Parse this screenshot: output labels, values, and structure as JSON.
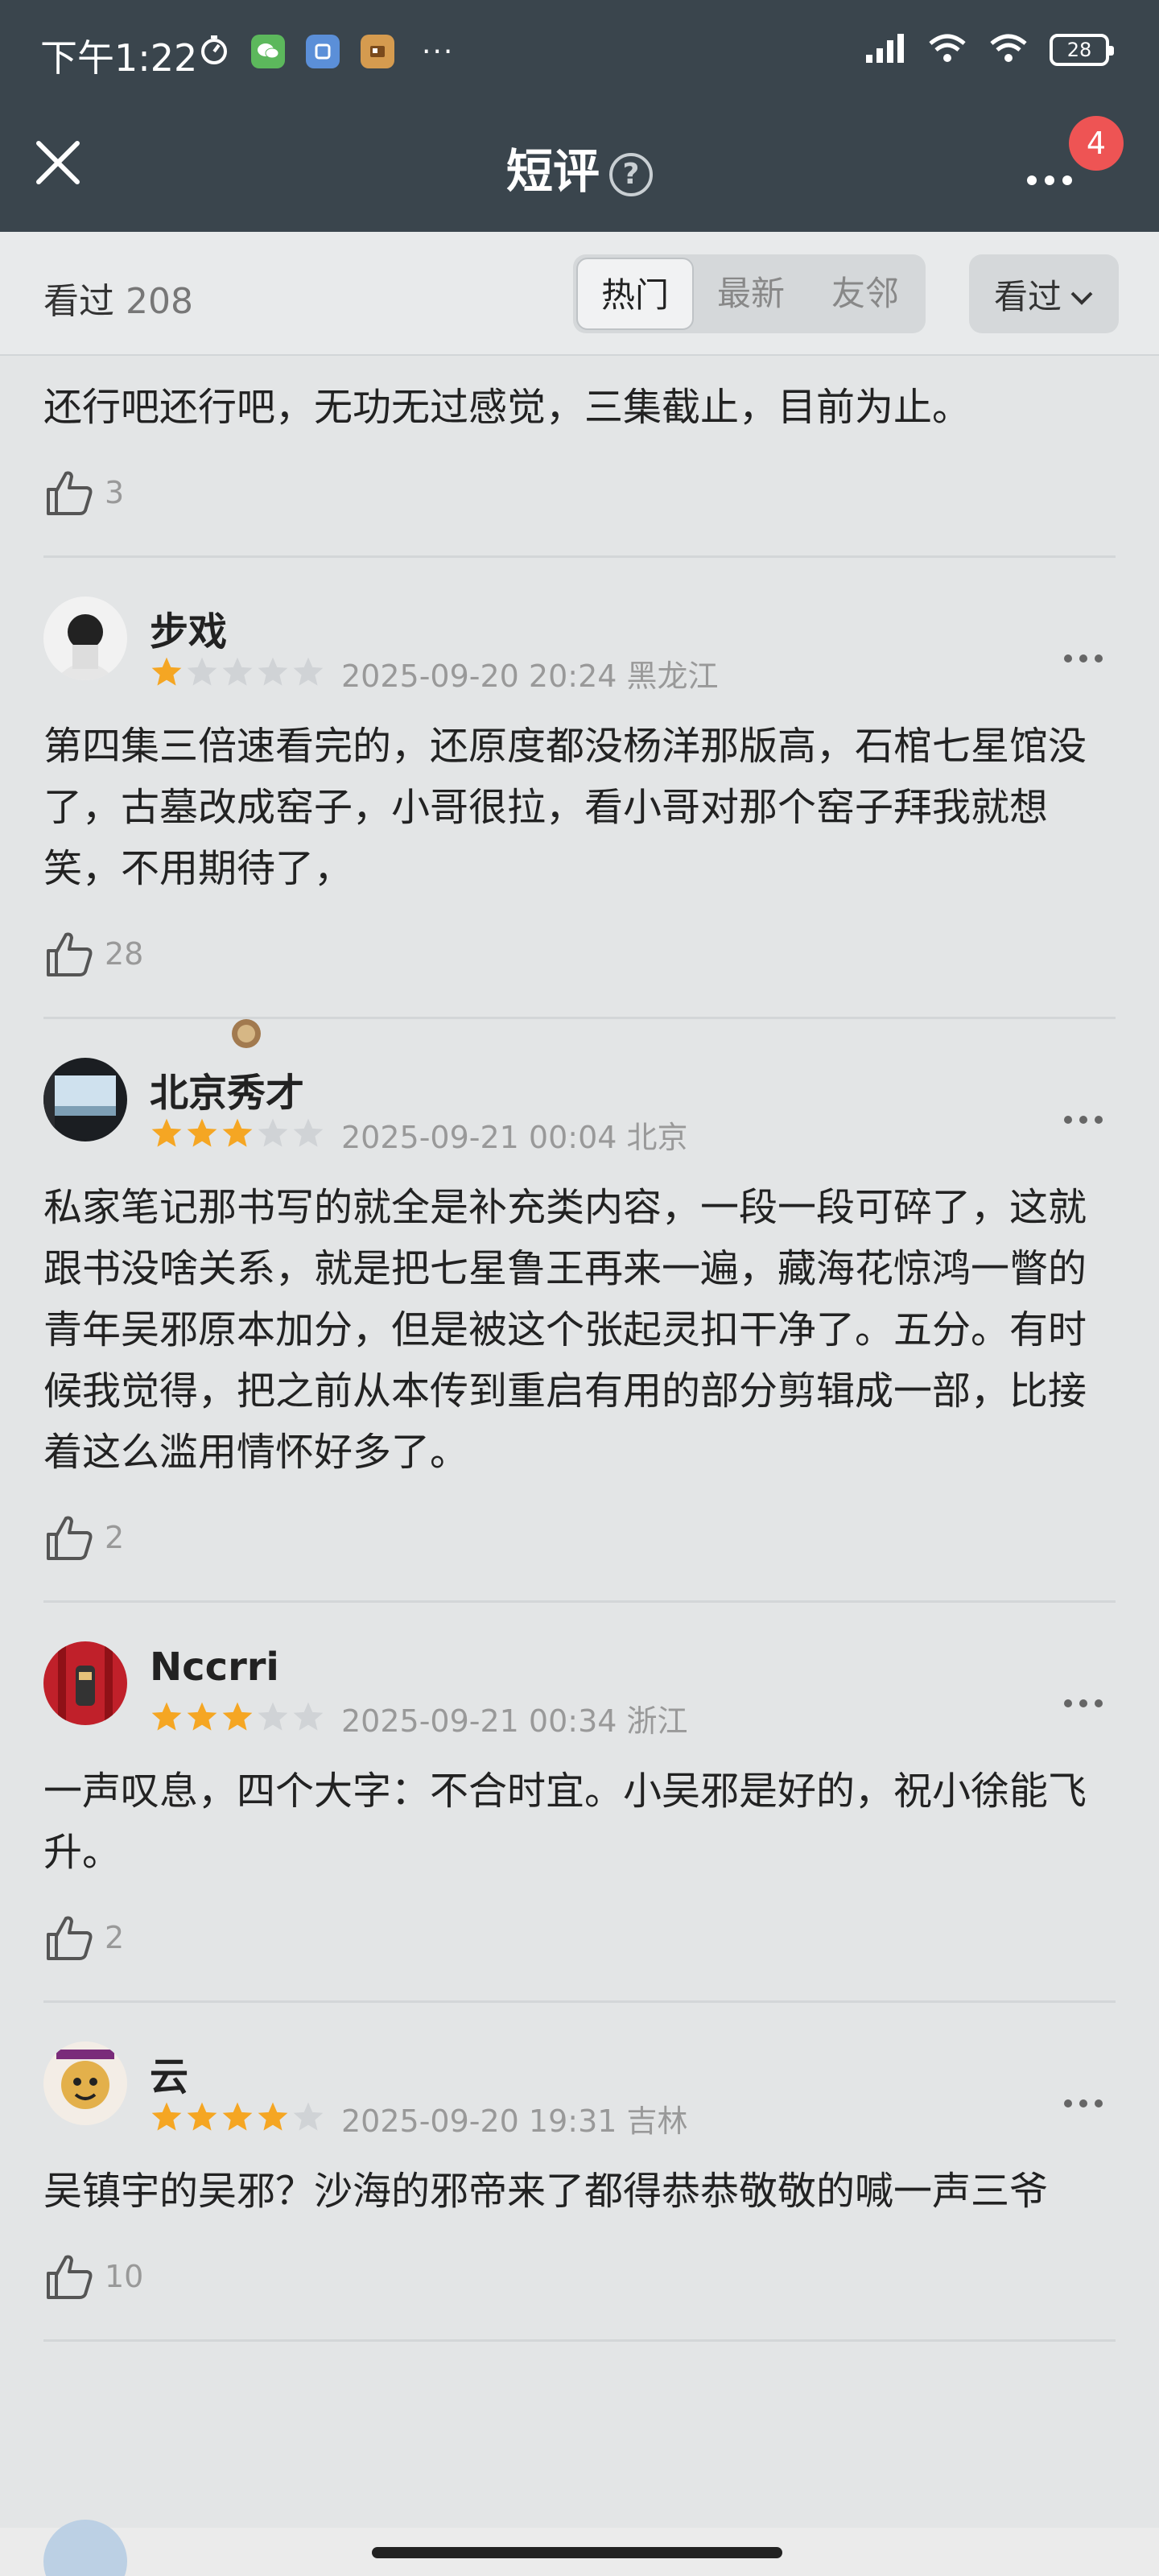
{
  "status_bar": {
    "time": "下午1:22",
    "battery": "28",
    "more": "···"
  },
  "titlebar": {
    "title": "短评",
    "help": "?",
    "badge_count": "4"
  },
  "filter": {
    "seen_label": "看过",
    "seen_count": "208",
    "tabs": [
      "热门",
      "最新",
      "友邻"
    ],
    "active_tab": "热门",
    "dropdown_label": "看过"
  },
  "first_partial": {
    "text": "还行吧还行吧，无功无过感觉，三集截止，目前为止。",
    "likes": "3"
  },
  "comments": [
    {
      "author": "步戏",
      "rating": 1,
      "time": "2025-09-20 20:24 黑龙江",
      "text": "第四集三倍速看完的，还原度都没杨洋那版高，石棺七星馆没了，古墓改成窑子，小哥很拉，看小哥对那个窑子拜我就想笑，不用期待了，",
      "likes": "28"
    },
    {
      "author": "北京秀才",
      "rating": 3,
      "time": "2025-09-21 00:04 北京",
      "text": "私家笔记那书写的就全是补充类内容，一段一段可碎了，这就跟书没啥关系，就是把七星鲁王再来一遍，藏海花惊鸿一瞥的青年吴邪原本加分，但是被这个张起灵扣干净了。五分。有时候我觉得，把之前从本传到重启有用的部分剪辑成一部，比接着这么滥用情怀好多了。",
      "likes": "2"
    },
    {
      "author": "Nccrri",
      "rating": 3,
      "time": "2025-09-21 00:34 浙江",
      "text": "一声叹息，四个大字：不合时宜。小吴邪是好的，祝小徐能飞升。",
      "likes": "2"
    },
    {
      "author": "云",
      "rating": 4,
      "time": "2025-09-20 19:31 吉林",
      "text": "吴镇宇的吴邪？沙海的邪帝来了都得恭恭敬敬的喊一声三爷",
      "likes": "10"
    }
  ],
  "colors": {
    "header_bg": "#3a454d",
    "star_on": "#f5a623",
    "star_off": "#d0d3d6",
    "badge": "#ee5454"
  }
}
